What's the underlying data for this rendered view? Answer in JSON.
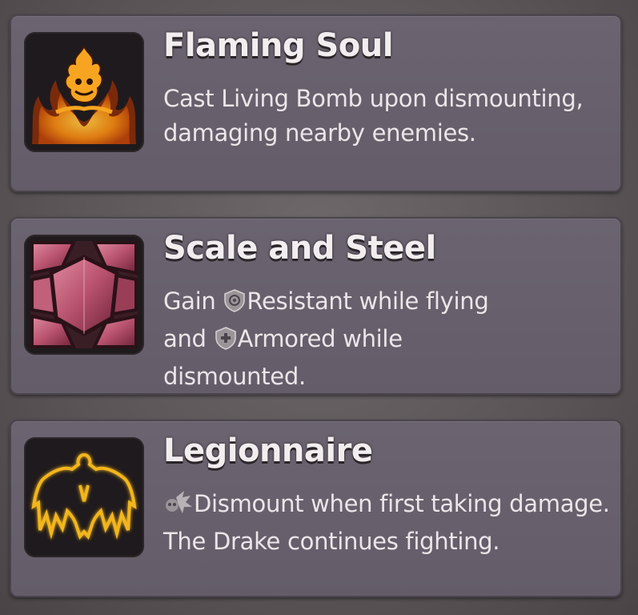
{
  "cards": [
    {
      "icon": "flaming-soul-icon",
      "title": "Flaming Soul",
      "description": "Cast Living Bomb upon dismounting, damaging nearby enemies."
    },
    {
      "icon": "scale-and-steel-icon",
      "title": "Scale and Steel",
      "desc_part1": "Gain ",
      "kw1_icon": "resistant-icon",
      "kw1": "Resistant while flying",
      "desc_part2": "and ",
      "kw2_icon": "armored-icon",
      "kw2": "Armored while",
      "desc_part3": "dismounted."
    },
    {
      "icon": "legionnaire-icon",
      "title": "Legionnaire",
      "kw_icon": "dismount-icon",
      "description": "Dismount when first taking damage. The Drake continues fighting."
    }
  ],
  "colors": {
    "card_bg": "#675f6b",
    "text": "#ece6ea",
    "fire": "#f29a1a",
    "gold_glow": "#f2b61e",
    "gem": "#b8526e"
  }
}
